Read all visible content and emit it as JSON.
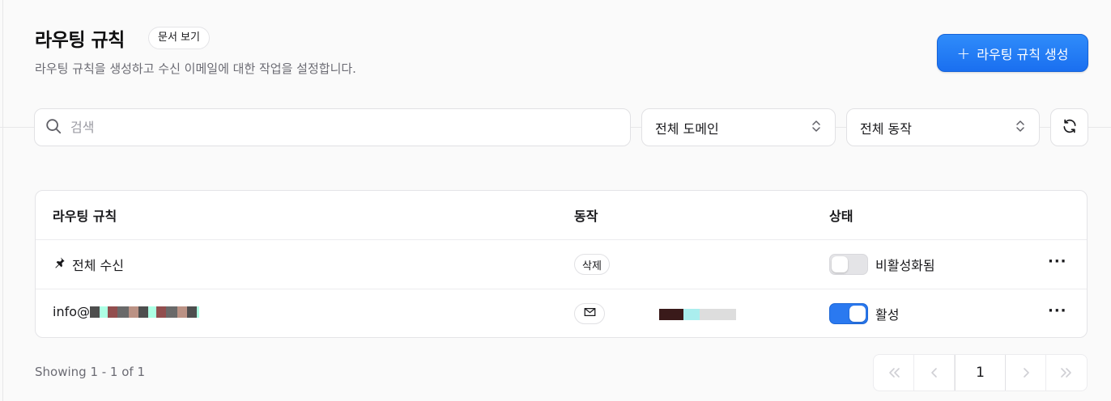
{
  "header": {
    "title": "라우팅 규칙",
    "doc_label": "문서 보기",
    "subtitle": "라우팅 규칙을 생성하고 수신 이메일에 대한 작업을 설정합니다.",
    "create_label": "라우팅 규칙 생성"
  },
  "filters": {
    "search_placeholder": "검색",
    "domain_value": "전체 도메인",
    "action_value": "전체 동작"
  },
  "table": {
    "columns": [
      "라우팅 규칙",
      "동작",
      "상태"
    ],
    "rows": [
      {
        "rule": "전체 수신",
        "action": "삭제",
        "status": "비활성화됨",
        "enabled": false,
        "icon": "pin-icon"
      },
      {
        "rule": "info@",
        "action": "",
        "status": "활성",
        "enabled": true,
        "icon": "mail-icon"
      }
    ]
  },
  "footer": {
    "showing": "Showing 1 - 1 of 1",
    "current_page": "1"
  },
  "colors": {
    "accent": "#1a6ff0",
    "toggle_on": "#2a79f0"
  }
}
